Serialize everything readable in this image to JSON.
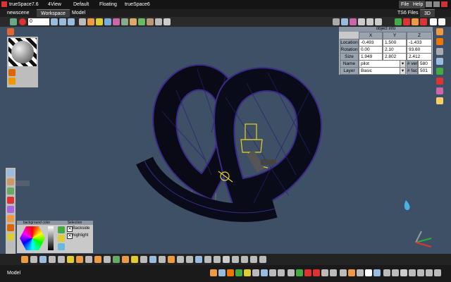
{
  "titlebar": {
    "app_title": "trueSpace7.6",
    "menu": [
      "4View",
      "Default",
      "Floating",
      "trueSpace6"
    ],
    "right": [
      "File",
      "Help"
    ]
  },
  "tabs": {
    "items": [
      "newscene",
      "Workspace",
      "Model"
    ],
    "ts6_files": "TS6 Files",
    "mode_3d": "3D"
  },
  "toolbar": {
    "frame_value": "0"
  },
  "object_info": {
    "title": "object info",
    "headers": [
      "X",
      "Y",
      "Z"
    ],
    "rows": [
      {
        "label": "Location",
        "x": "-0.493",
        "y": "1.500",
        "z": "-1.433"
      },
      {
        "label": "Rotation",
        "x": "0.00",
        "y": "2.10",
        "z": "93.60"
      },
      {
        "label": "Size",
        "x": "1.949",
        "y": "2.802",
        "z": "2.412"
      }
    ],
    "name_label": "Name",
    "name_value": "pilot",
    "vert_label": "# ver",
    "vert_value": "580",
    "layer_label": "Layer",
    "layer_value": "Basic",
    "face_label": "# fac",
    "face_value": "501"
  },
  "bg_color_panel": {
    "title": "background color"
  },
  "selection_panel": {
    "title": "Selection",
    "options": [
      {
        "label": "Backside",
        "checked": true
      },
      {
        "label": "highlight",
        "checked": true
      }
    ]
  },
  "status": {
    "mode": "Model"
  },
  "colors": {
    "viewport": "#3d5066",
    "wire": "#3a2a8a",
    "highlight": "#e8d21c"
  }
}
